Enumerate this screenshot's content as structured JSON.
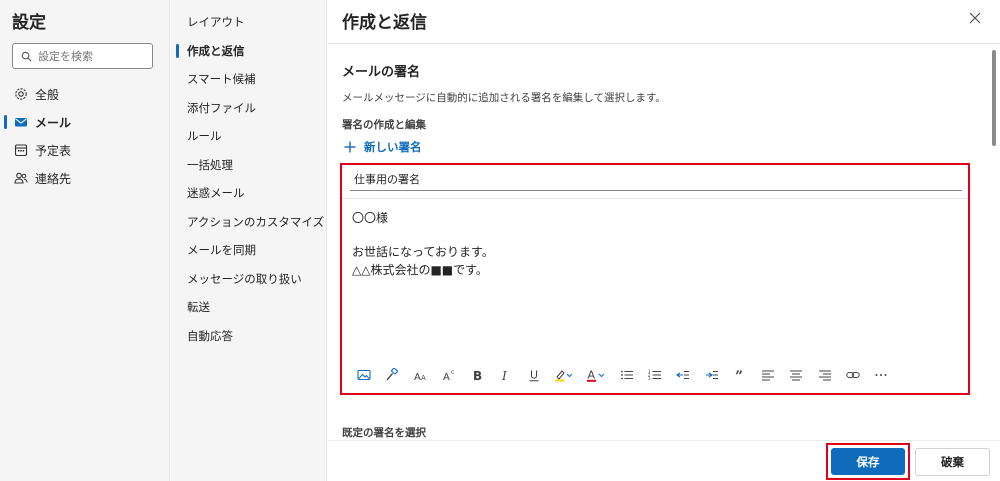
{
  "settings": {
    "title": "設定",
    "search_placeholder": "設定を検索",
    "nav": [
      {
        "label": "全般",
        "icon": "gear-icon"
      },
      {
        "label": "メール",
        "icon": "mail-icon"
      },
      {
        "label": "予定表",
        "icon": "calendar-icon"
      },
      {
        "label": "連絡先",
        "icon": "people-icon"
      }
    ]
  },
  "mail_nav": [
    "レイアウト",
    "作成と返信",
    "スマート候補",
    "添付ファイル",
    "ルール",
    "一括処理",
    "迷惑メール",
    "アクションのカスタマイズ",
    "メールを同期",
    "メッセージの取り扱い",
    "転送",
    "自動応答"
  ],
  "panel": {
    "title": "作成と返信",
    "section_title": "メールの署名",
    "description": "メールメッセージに自動的に追加される署名を編集して選択します。",
    "sub_label": "署名の作成と編集",
    "new_signature": "新しい署名",
    "signature_name": "仕事用の署名",
    "body": {
      "line1": "〇〇様",
      "line2": "お世話になっております。",
      "line3": "△△株式会社の■■です。"
    },
    "default_label": "既定の署名を選択",
    "save": "保存",
    "discard": "破棄"
  },
  "colors": {
    "accent": "#0f6cbd",
    "highlight_frame": "#e0001b"
  }
}
